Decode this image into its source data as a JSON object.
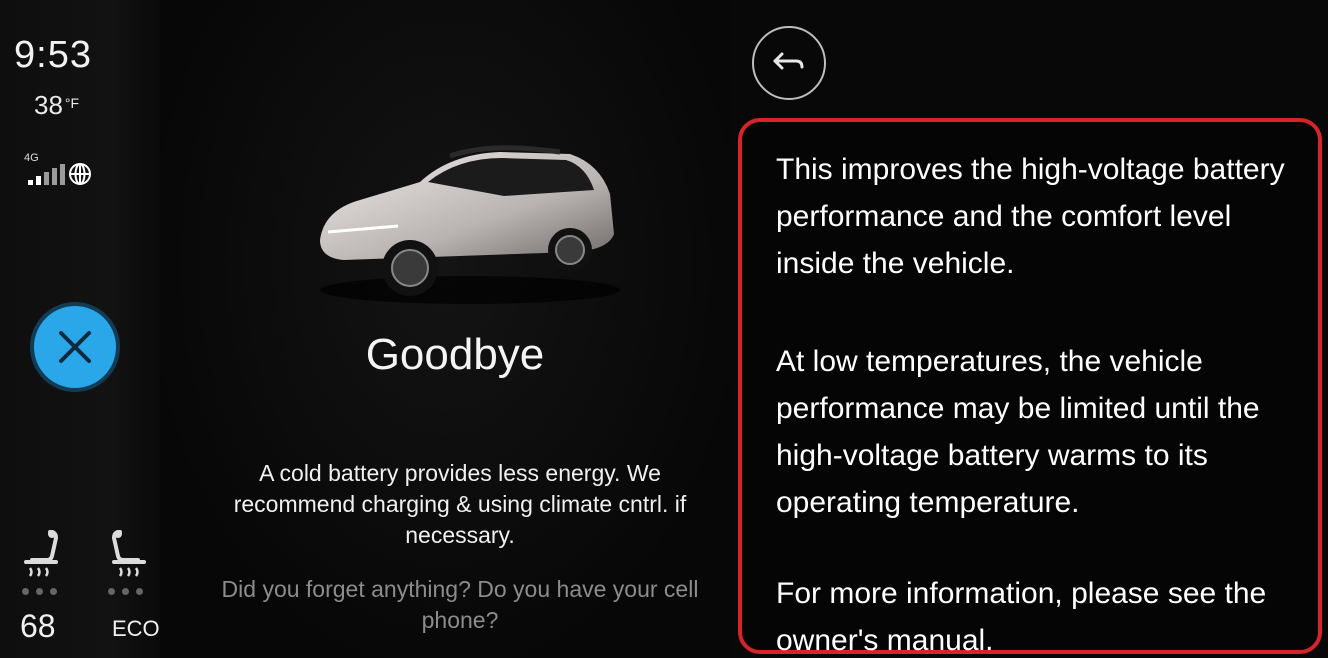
{
  "status": {
    "time": "9:53",
    "temperature": "38",
    "temperature_unit": "°F",
    "network": "4G"
  },
  "climate": {
    "set_temperature": "68",
    "mode": "ECO"
  },
  "goodbye": {
    "title": "Goodbye",
    "cold_battery_message": "A cold battery provides less energy. We recommend charging & using climate cntrl. if necessary.",
    "reminder": "Did you forget anything? Do you have your cell phone?"
  },
  "info": {
    "paragraph_1": "This improves the high-voltage battery performance and the comfort level inside the vehicle.",
    "paragraph_2": "At low temperatures, the vehicle performance may be limited until the high-voltage battery warms to its operating temperature.",
    "paragraph_3": "For more information, please see the owner's manual."
  },
  "colors": {
    "close_button": "#2aa7e8",
    "info_border": "#d6242a",
    "reminder_text": "#8c8c8c"
  },
  "icons": {
    "close": "x-icon",
    "back": "back-arrow-icon",
    "signal": "signal-bars-icon",
    "globe": "globe-icon",
    "seat_heat_left": "seat-heater-icon",
    "seat_heat_right": "seat-heater-icon",
    "car": "vehicle-image"
  }
}
